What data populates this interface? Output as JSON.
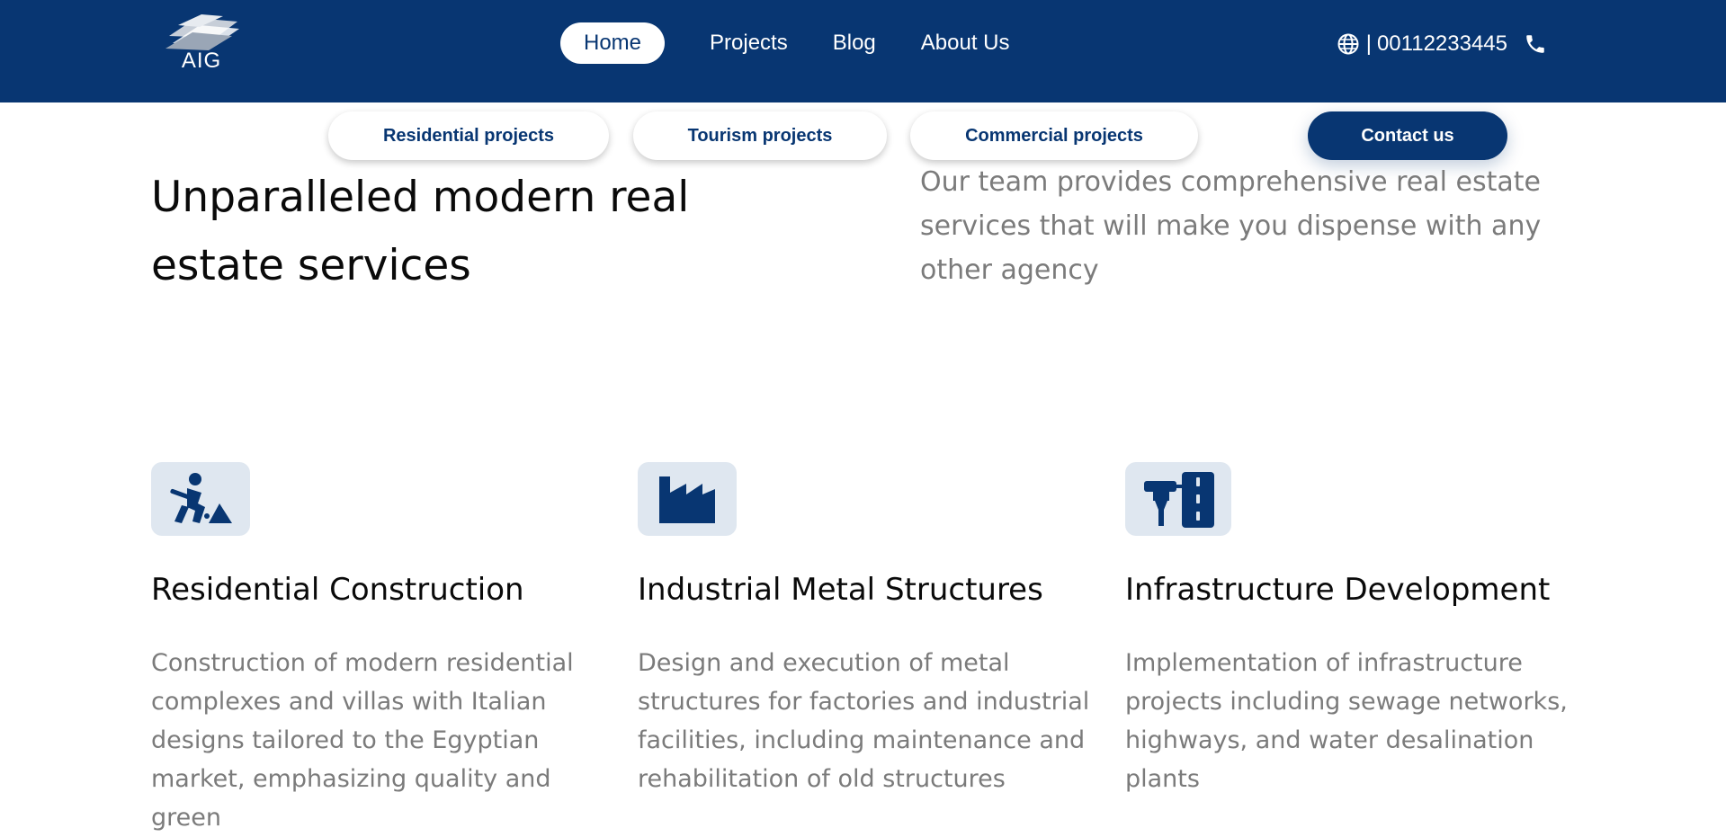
{
  "brand": {
    "logo_text": "AIG",
    "primary_color": "#083672",
    "icon_bg": "#dfe7f0"
  },
  "nav": {
    "items": [
      {
        "label": "Home",
        "active": true
      },
      {
        "label": "Projects",
        "active": false
      },
      {
        "label": "Blog",
        "active": false
      },
      {
        "label": "About Us",
        "active": false
      }
    ]
  },
  "contact": {
    "separator": "|",
    "phone": "00112233445",
    "icons": [
      "globe-icon",
      "phone-icon"
    ]
  },
  "subnav": {
    "residential": "Residential projects",
    "tourism": "Tourism projects",
    "commercial": "Commercial projects",
    "contact_us": "Contact us"
  },
  "hero": {
    "title": "Unparalleled modern real estate services",
    "description": "Our team provides comprehensive real estate services that will make you dispense with any other agency"
  },
  "services": [
    {
      "icon": "construction-worker-icon",
      "title": "Residential Construction",
      "description": "Construction of modern residential complexes and villas with Italian designs tailored to the Egyptian market, emphasizing quality and green"
    },
    {
      "icon": "factory-icon",
      "title": "Industrial Metal Structures",
      "description": "Design and execution of metal structures for factories and industrial facilities, including maintenance and rehabilitation of old structures"
    },
    {
      "icon": "road-paint-icon",
      "title": "Infrastructure Development",
      "description": "Implementation of infrastructure projects including sewage networks, highways, and water desalination plants"
    }
  ]
}
